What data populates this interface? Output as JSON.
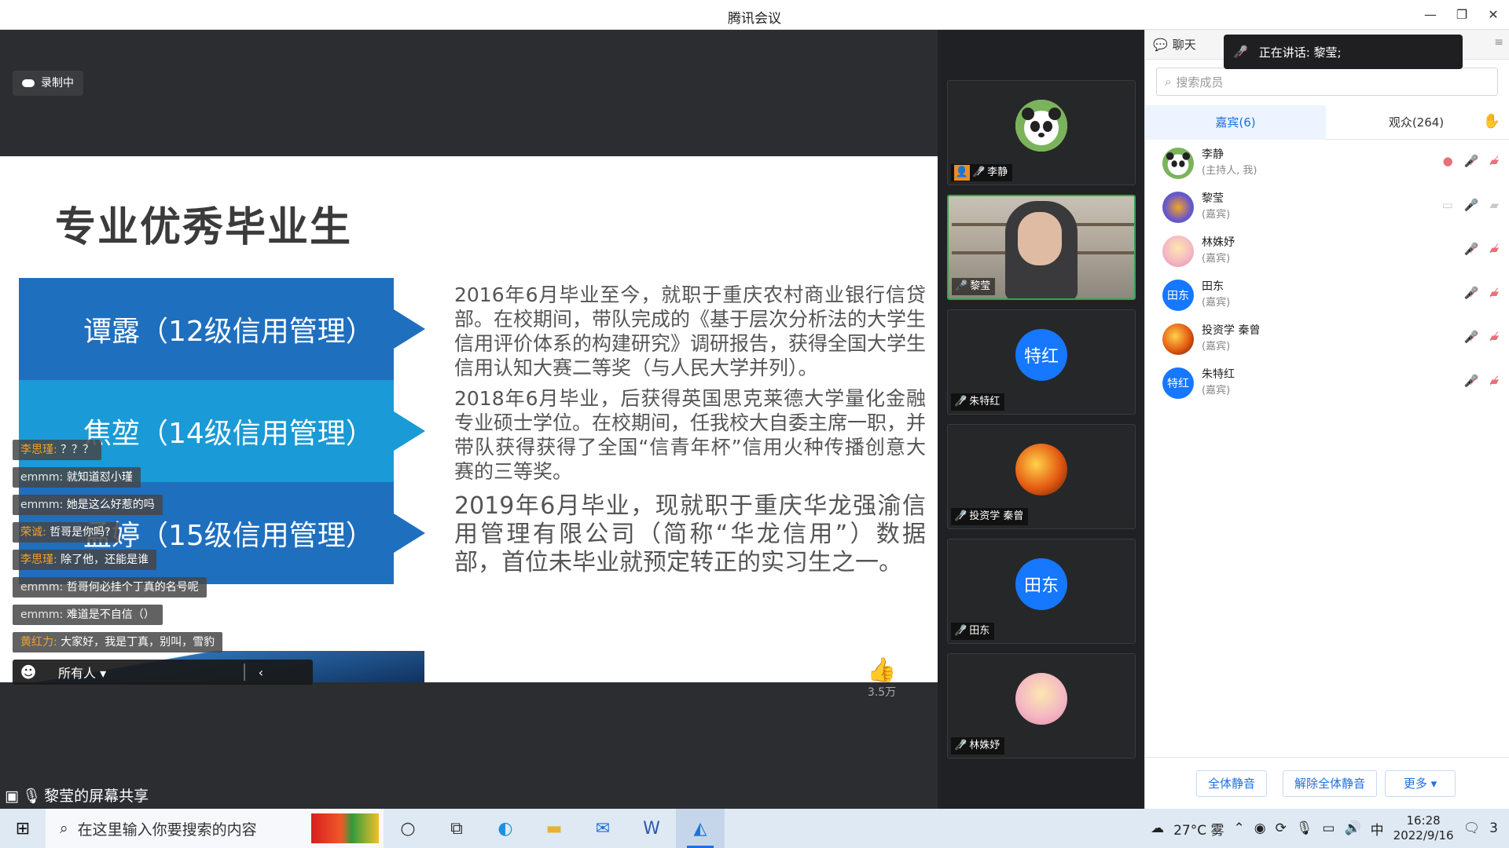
{
  "window": {
    "title": "腾讯会议"
  },
  "stage": {
    "recording_label": "录制中",
    "slide": {
      "title": "专业优秀毕业生",
      "bands": [
        "谭露（12级信用管理）",
        "焦堃（14级信用管理）",
        "孟婷（15级信用管理）"
      ],
      "paragraphs": [
        "2016年6月毕业至今，就职于重庆农村商业银行信贷部。在校期间，带队完成的《基于层次分析法的大学生信用评价体系的构建研究》调研报告，获得全国大学生信用认知大赛二等奖（与人民大学并列）。",
        "2018年6月毕业，后获得英国思克莱德大学量化金融专业硕士学位。在校期间，任我校大自委主席一职，并带队获得获得了全国“信青年杯”信用火种传播创意大赛的三等奖。",
        "2019年6月毕业，现就职于重庆华龙强渝信用管理有限公司（简称“华龙信用”）数据部，首位未毕业就预定转正的实习生之一。"
      ]
    },
    "like_count": "3.5万",
    "danmaku": [
      {
        "user": "李思瑾:",
        "text": " ？？？",
        "accent": true
      },
      {
        "user": "emmm:",
        "text": " 就知道怼小瑾",
        "accent": false
      },
      {
        "user": "emmm:",
        "text": " 她是这么好惹的吗",
        "accent": false
      },
      {
        "user": "荣诚:",
        "text": " 哲哥是你吗?",
        "accent": true
      },
      {
        "user": "李思瑾:",
        "text": " 除了他，还能是谁",
        "accent": true
      },
      {
        "user": "emmm:",
        "text": " 哲哥何必挂个丁真的名号呢",
        "accent": false
      },
      {
        "user": "emmm:",
        "text": " 难道是不自信（）",
        "accent": false
      },
      {
        "user": "黄红力:",
        "text": " 大家好，我是丁真，别叫，雪豹",
        "accent": true
      }
    ],
    "chat_input": {
      "target": "所有人 ▾"
    },
    "share_label": "黎莹的屏幕共享"
  },
  "video_tiles": [
    {
      "name": "李静",
      "avatar_text": "",
      "avatar_color": "#e8e8e8",
      "icon": "panda-avatar"
    },
    {
      "name": "黎莹",
      "avatar_text": "",
      "avatar_color": "#000000",
      "icon": "video-feed"
    },
    {
      "name": "朱特红",
      "avatar_text": "特红",
      "avatar_color": "#1677ff",
      "icon": "text-avatar"
    },
    {
      "name": "投资学 秦曾",
      "avatar_text": "",
      "avatar_color": "#c94a10",
      "icon": "fire-avatar"
    },
    {
      "name": "田东",
      "avatar_text": "田东",
      "avatar_color": "#1677ff",
      "icon": "text-avatar"
    },
    {
      "name": "林姝妤",
      "avatar_text": "",
      "avatar_color": "#f3d5d9",
      "icon": "anime-avatar"
    }
  ],
  "panel": {
    "chat_tab": "聊天",
    "speaking": "正在讲话: 黎莹;",
    "search_placeholder": "搜索成员",
    "tabs": {
      "guests": "嘉宾(6)",
      "audience": "观众(264)"
    },
    "members": [
      {
        "name": "李静",
        "role": "(主持人, 我)",
        "avatar_text": "",
        "avatar_color": "#e8e8e8"
      },
      {
        "name": "黎莹",
        "role": "(嘉宾)",
        "avatar_text": "",
        "avatar_color": "#6a55c8"
      },
      {
        "name": "林姝妤",
        "role": "(嘉宾)",
        "avatar_text": "",
        "avatar_color": "#f3c9d2"
      },
      {
        "name": "田东",
        "role": "(嘉宾)",
        "avatar_text": "田东",
        "avatar_color": "#1677ff"
      },
      {
        "name": "投资学 秦曾",
        "role": "(嘉宾)",
        "avatar_text": "",
        "avatar_color": "#c94a10"
      },
      {
        "name": "朱特红",
        "role": "(嘉宾)",
        "avatar_text": "特红",
        "avatar_color": "#1677ff"
      }
    ],
    "footer": {
      "mute_all": "全体静音",
      "unmute_all": "解除全体静音",
      "more": "更多 ▾"
    }
  },
  "taskbar": {
    "search_text": "在这里输入你要搜索的内容",
    "weather": "27°C 雾",
    "ime": "中",
    "time": "16:28",
    "date": "2022/9/16",
    "notifications": "3"
  }
}
